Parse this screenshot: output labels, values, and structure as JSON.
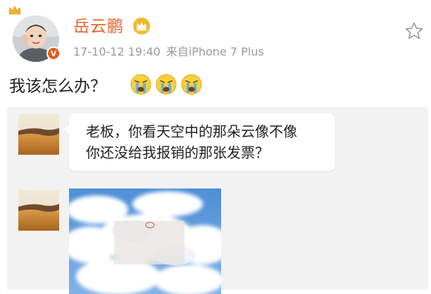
{
  "user": {
    "name": "岳云鹏",
    "verified_mark": "V",
    "vip_icon": "crown-icon",
    "avatar_badge_icon": "crown-icon"
  },
  "post": {
    "timestamp": "17-10-12 19:40",
    "source": "来自iPhone 7 Plus",
    "text": "我该怎么办？",
    "emojis": [
      "crying-face-icon",
      "crying-face-icon",
      "crying-face-icon"
    ],
    "favorite_icon": "star-outline-icon"
  },
  "repost": {
    "message_line1": "老板，你看天空中的那朵云像不像",
    "message_line2": "你还没给我报销的那张发票？",
    "thumbnail_icon": "desert-landscape-image",
    "photo_icon": "cloud-sky-image"
  },
  "colors": {
    "username": "#e8602a",
    "meta": "#9a9a9a",
    "repost_background": "#f2f2f2",
    "verified_badge": "#e85a1b"
  }
}
